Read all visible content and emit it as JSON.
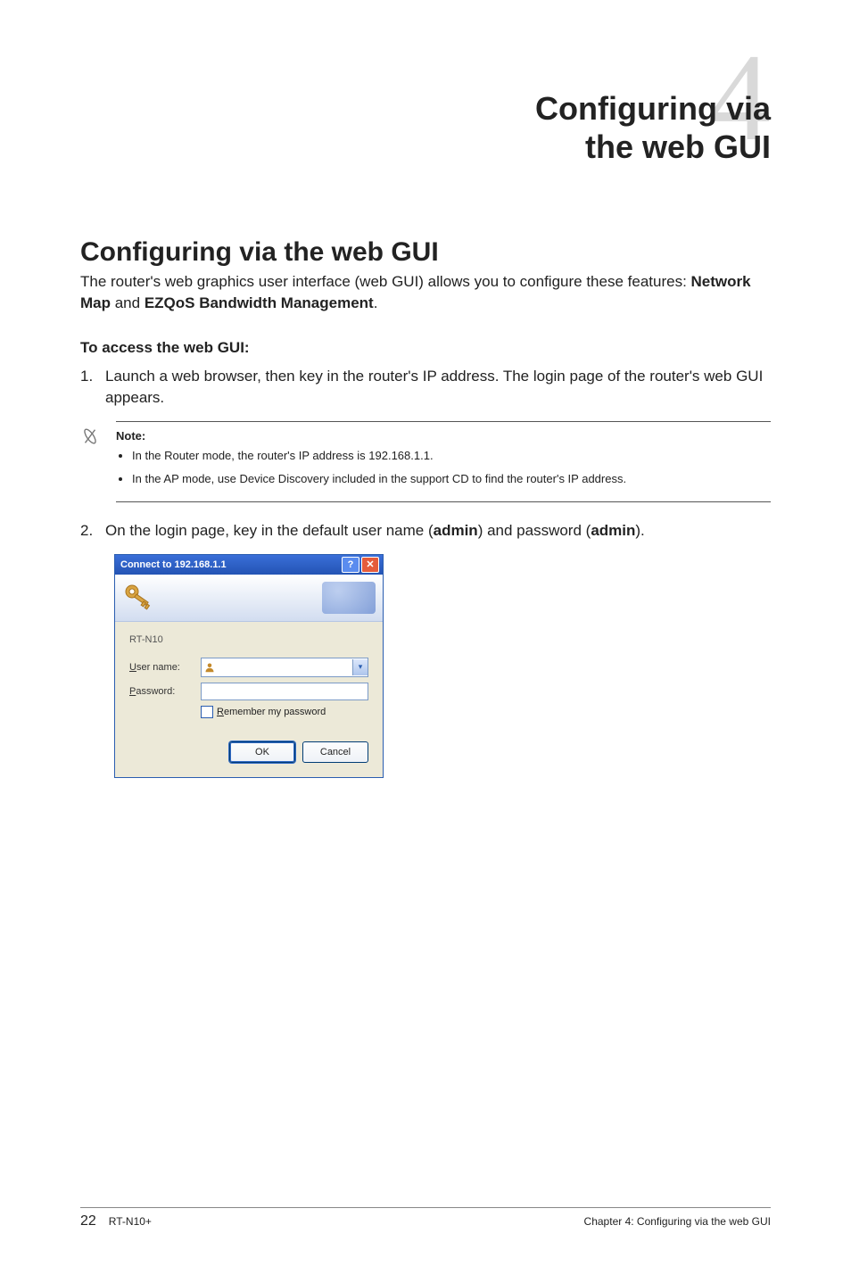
{
  "chapter": {
    "number": "4",
    "title_line1": "Configuring via",
    "title_line2": "the web GUI"
  },
  "section": {
    "heading": "Configuring via the web GUI",
    "intro_pre": "The router's web graphics user interface (web GUI) allows you to configure these features: ",
    "intro_bold1": "Network Map",
    "intro_mid": " and ",
    "intro_bold2": "EZQoS Bandwidth Management",
    "intro_post": "."
  },
  "instructions": {
    "subheading": "To access the web GUI:",
    "steps": [
      {
        "num": "1.",
        "text": "Launch a web browser, then key in the router's IP address. The login page of the router's web GUI appears."
      },
      {
        "num": "2.",
        "pre": "On the login page, key in the default user name (",
        "b1": "admin",
        "mid": ") and password (",
        "b2": "admin",
        "post": ")."
      }
    ]
  },
  "note": {
    "label": "Note:",
    "bullets": [
      "In the Router mode, the router's IP address is 192.168.1.1.",
      "In the AP mode, use Device Discovery included in the support CD to find the router's IP address."
    ]
  },
  "dialog": {
    "title": "Connect to 192.168.1.1",
    "server": "RT-N10",
    "username_label_u": "U",
    "username_label_rest": "ser name:",
    "username_value": "",
    "password_label_u": "P",
    "password_label_rest": "assword:",
    "password_value": "",
    "remember_u": "R",
    "remember_rest": "emember my password",
    "ok": "OK",
    "cancel": "Cancel",
    "help_glyph": "?",
    "close_glyph": "✕",
    "arrow_glyph": "▾"
  },
  "footer": {
    "page": "22",
    "model": "RT-N10+",
    "chapter_ref": "Chapter 4: Configuring via the web GUI"
  }
}
